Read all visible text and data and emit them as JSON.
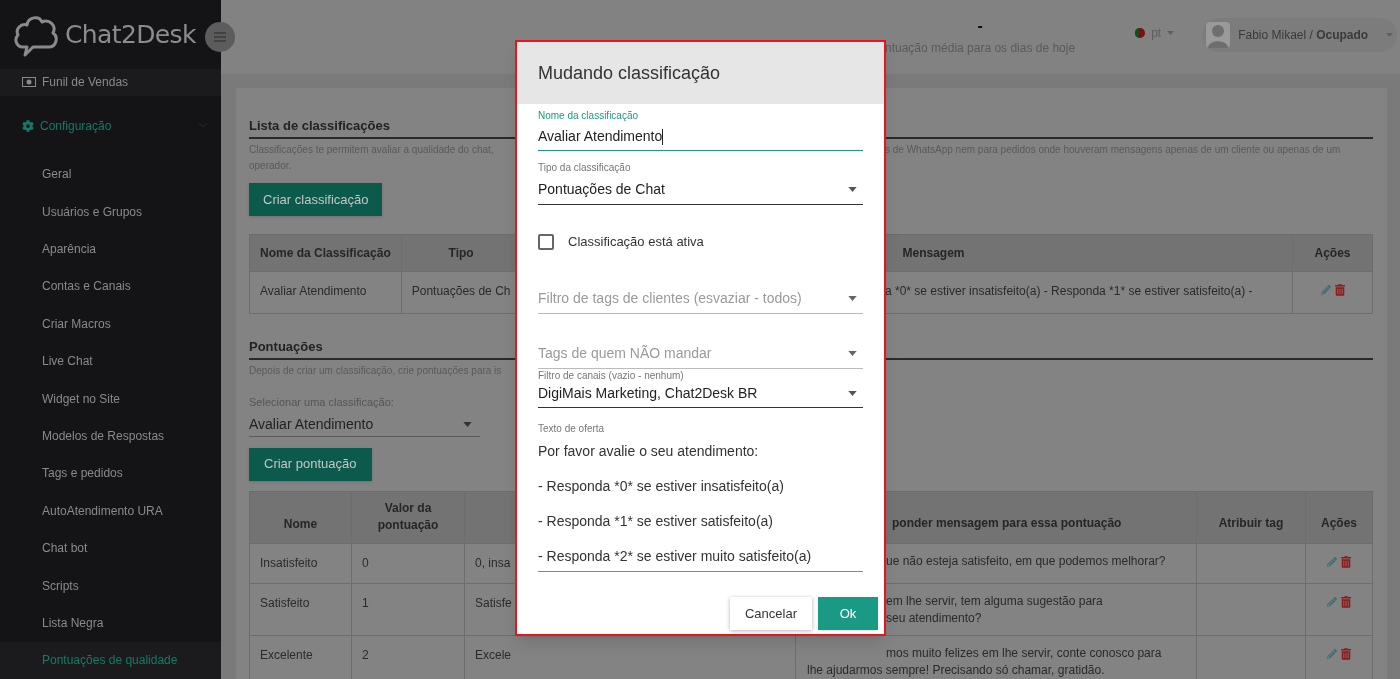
{
  "sidebar": {
    "logo": "Chat2Desk",
    "top_item": {
      "label": "Funil de Vendas",
      "selected": false
    },
    "section": {
      "label": "Configuração",
      "expanded": true,
      "children": [
        {
          "label": "Geral",
          "selected": false
        },
        {
          "label": "Usuários e Grupos",
          "selected": false
        },
        {
          "label": "Aparência",
          "selected": false
        },
        {
          "label": "Contas e Canais",
          "selected": false
        },
        {
          "label": "Criar Macros",
          "selected": false
        },
        {
          "label": "Live Chat",
          "selected": false
        },
        {
          "label": "Widget no Site",
          "selected": false
        },
        {
          "label": "Modelos de Respostas",
          "selected": false
        },
        {
          "label": "Tags e pedidos",
          "selected": false
        },
        {
          "label": "AutoAtendimento URA",
          "selected": false
        },
        {
          "label": "Chat bot",
          "selected": false
        },
        {
          "label": "Scripts",
          "selected": false
        },
        {
          "label": "Lista Negra",
          "selected": false
        },
        {
          "label": "Pontuações de qualidade",
          "selected": true
        }
      ]
    }
  },
  "header": {
    "score_value": "-",
    "score_caption": "ntuação média para os dias de hoje",
    "language": "pt",
    "user": "Fabio Mikael / **Ocupado**"
  },
  "classifications": {
    "title": "Lista de classificações",
    "description_left": "Classificações te permitem avaliar a qualidade do chat, ",
    "description_right": "s de WhatsApp nem para pedidos onde houveram mensagens apenas de um cliente ou apenas de um",
    "description_line2": "operador.",
    "create_button": "Criar classificação",
    "table": {
      "left_columns": [
        "Nome da Classificação",
        "Tipo"
      ],
      "right_columns": [
        "Mensagem",
        "Ações"
      ],
      "rows": [
        {
          "left_cells": [
            "Avaliar Atendimento",
            "Pontuações de Ch"
          ],
          "message": "a *0* se estiver insatisfeito(a) - Responda *1* se estiver satisfeito(a) -"
        }
      ]
    }
  },
  "scores": {
    "title": "Pontuações",
    "description": "Depois de criar um classificação, crie pontuações para is",
    "select_label": "Selecionar uma classificação:",
    "select_value": "Avaliar Atendimento",
    "create_button": "Criar pontuação",
    "table": {
      "left_columns": [
        "Nome",
        "Valor da pontuação"
      ],
      "right_columns": [
        "ponder mensagem para essa pontuação",
        "Atribuir tag",
        "Ações"
      ],
      "rows": [
        {
          "left_cells": [
            "Insatisfeito",
            "0",
            "0, insa"
          ],
          "reply_lines": [
            "ue não esteja satisfeito, em que podemos melhorar?"
          ]
        },
        {
          "left_cells": [
            "Satisfeito",
            "1",
            "Satisfe"
          ],
          "reply_lines": [
            "em lhe servir, tem alguma sugestão para",
            "seu atendimento?"
          ]
        },
        {
          "left_cells": [
            "Excelente",
            "2",
            "Excele"
          ],
          "reply_lines": [
            "mos muito felizes em lhe servir, conte conosco para",
            "lhe ajudarmos sempre! Precisando só chamar, gratidão."
          ]
        }
      ]
    }
  },
  "modal": {
    "title": "Mudando classificação",
    "name_field": {
      "label": "Nome da classificação",
      "value": "Avaliar Atendimento",
      "focused": true
    },
    "type_field": {
      "label": "Tipo da classificação",
      "value": "Pontuações de Chat"
    },
    "active_checkbox": {
      "label": "Classificação está ativa",
      "checked": false
    },
    "client_tags_field": {
      "placeholder": "Filtro de tags de clientes (esvaziar - todos)"
    },
    "exclude_tags_field": {
      "placeholder": "Tags de quem NÃO mandar"
    },
    "channels_field": {
      "label": "Filtro de canais (vazio - nenhum)",
      "value": "DigiMais Marketing, Chat2Desk BR"
    },
    "offer_text": {
      "label": "Texto de oferta",
      "lines": [
        "Por favor avalie o seu atendimento:",
        "- Responda *0* se estiver insatisfeito(a)",
        "- Responda *1* se estiver satisfeito(a)",
        "- Responda *2* se estiver muito satisfeito(a)"
      ]
    },
    "cancel_button": "Cancelar",
    "ok_button": "Ok"
  }
}
